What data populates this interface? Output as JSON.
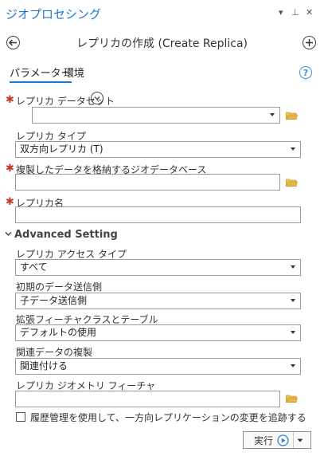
{
  "pane": {
    "title": "ジオプロセシング",
    "menu_glyph": "▾",
    "pin_glyph": "⊥",
    "close_glyph": "✕"
  },
  "tool": {
    "title": "レプリカの作成 (Create Replica)"
  },
  "tabs": [
    {
      "label": "パラメーター",
      "active": true
    },
    {
      "label": "環境",
      "active": false
    }
  ],
  "help_glyph": "?",
  "params": {
    "replica_dataset": {
      "label": "レプリカ データセット",
      "value": "",
      "required": true
    },
    "replica_type": {
      "label": "レプリカ タイプ",
      "value": "双方向レプリカ (T)"
    },
    "geodatabase": {
      "label": "複製したデータを格納するジオデータベース",
      "value": "",
      "required": true
    },
    "replica_name": {
      "label": "レプリカ名",
      "value": "",
      "required": true
    }
  },
  "advanced": {
    "title": "Advanced Setting",
    "access_type": {
      "label": "レプリカ アクセス タイプ",
      "value": "すべて"
    },
    "initial_sender": {
      "label": "初期のデータ送信側",
      "value": "子データ送信側"
    },
    "expand_features": {
      "label": "拡張フィーチャクラスとテーブル",
      "value": "デフォルトの使用"
    },
    "related_data": {
      "label": "関連データの複製",
      "value": "関連付ける"
    },
    "geometry_feature": {
      "label": "レプリカ ジオメトリ フィーチャ",
      "value": ""
    },
    "archive_checkbox": {
      "label": "履歴管理を使用して、一方向レプリケーションの変更を追跡する",
      "checked": false
    }
  },
  "run": {
    "label": "実行"
  },
  "colors": {
    "accent": "#1f78c8",
    "required": "#c0392b",
    "folder": "#e8b84a"
  }
}
